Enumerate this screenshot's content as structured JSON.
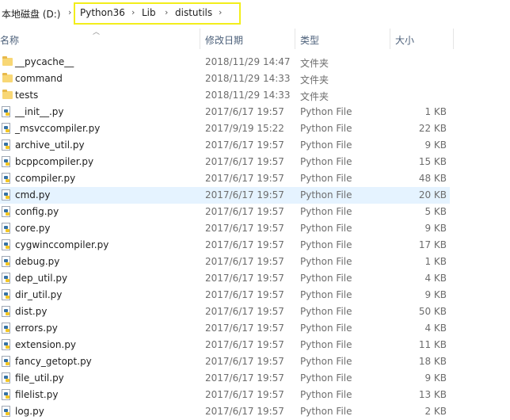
{
  "breadcrumb": {
    "root": "本地磁盘 (D:)",
    "items": [
      "Python36",
      "Lib",
      "distutils"
    ],
    "separator": "›"
  },
  "columns": {
    "name": "名称",
    "date": "修改日期",
    "type": "类型",
    "size": "大小"
  },
  "files": [
    {
      "name": "__pycache__",
      "date": "2018/11/29 14:47",
      "type": "文件夹",
      "size": "",
      "icon": "folder-icon"
    },
    {
      "name": "command",
      "date": "2018/11/29 14:33",
      "type": "文件夹",
      "size": "",
      "icon": "folder-icon"
    },
    {
      "name": "tests",
      "date": "2018/11/29 14:33",
      "type": "文件夹",
      "size": "",
      "icon": "folder-icon"
    },
    {
      "name": "__init__.py",
      "date": "2017/6/17 19:57",
      "type": "Python File",
      "size": "1 KB",
      "icon": "python-file-icon"
    },
    {
      "name": "_msvccompiler.py",
      "date": "2017/9/19 15:22",
      "type": "Python File",
      "size": "22 KB",
      "icon": "python-file-icon"
    },
    {
      "name": "archive_util.py",
      "date": "2017/6/17 19:57",
      "type": "Python File",
      "size": "9 KB",
      "icon": "python-file-icon"
    },
    {
      "name": "bcppcompiler.py",
      "date": "2017/6/17 19:57",
      "type": "Python File",
      "size": "15 KB",
      "icon": "python-file-icon"
    },
    {
      "name": "ccompiler.py",
      "date": "2017/6/17 19:57",
      "type": "Python File",
      "size": "48 KB",
      "icon": "python-file-icon"
    },
    {
      "name": "cmd.py",
      "date": "2017/6/17 19:57",
      "type": "Python File",
      "size": "20 KB",
      "icon": "python-file-icon",
      "selected": true
    },
    {
      "name": "config.py",
      "date": "2017/6/17 19:57",
      "type": "Python File",
      "size": "5 KB",
      "icon": "python-file-icon"
    },
    {
      "name": "core.py",
      "date": "2017/6/17 19:57",
      "type": "Python File",
      "size": "9 KB",
      "icon": "python-file-icon"
    },
    {
      "name": "cygwinccompiler.py",
      "date": "2017/6/17 19:57",
      "type": "Python File",
      "size": "17 KB",
      "icon": "python-file-icon"
    },
    {
      "name": "debug.py",
      "date": "2017/6/17 19:57",
      "type": "Python File",
      "size": "1 KB",
      "icon": "python-file-icon"
    },
    {
      "name": "dep_util.py",
      "date": "2017/6/17 19:57",
      "type": "Python File",
      "size": "4 KB",
      "icon": "python-file-icon"
    },
    {
      "name": "dir_util.py",
      "date": "2017/6/17 19:57",
      "type": "Python File",
      "size": "9 KB",
      "icon": "python-file-icon"
    },
    {
      "name": "dist.py",
      "date": "2017/6/17 19:57",
      "type": "Python File",
      "size": "50 KB",
      "icon": "python-file-icon"
    },
    {
      "name": "errors.py",
      "date": "2017/6/17 19:57",
      "type": "Python File",
      "size": "4 KB",
      "icon": "python-file-icon"
    },
    {
      "name": "extension.py",
      "date": "2017/6/17 19:57",
      "type": "Python File",
      "size": "11 KB",
      "icon": "python-file-icon"
    },
    {
      "name": "fancy_getopt.py",
      "date": "2017/6/17 19:57",
      "type": "Python File",
      "size": "18 KB",
      "icon": "python-file-icon"
    },
    {
      "name": "file_util.py",
      "date": "2017/6/17 19:57",
      "type": "Python File",
      "size": "9 KB",
      "icon": "python-file-icon"
    },
    {
      "name": "filelist.py",
      "date": "2017/6/17 19:57",
      "type": "Python File",
      "size": "13 KB",
      "icon": "python-file-icon"
    },
    {
      "name": "log.py",
      "date": "2017/6/17 19:57",
      "type": "Python File",
      "size": "2 KB",
      "icon": "python-file-icon"
    }
  ],
  "colors": {
    "highlight_box": "#f2ee1b",
    "selected_row": "#e5f3ff",
    "header_text": "#4c607a"
  }
}
